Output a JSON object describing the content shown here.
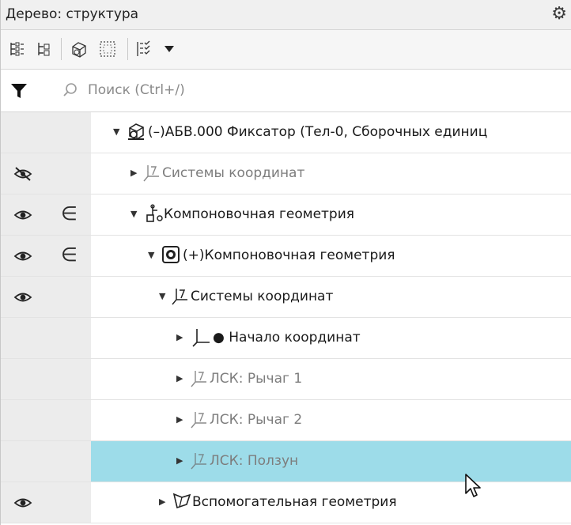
{
  "panel": {
    "title": "Дерево: структура",
    "settings_icon": "gear-icon"
  },
  "toolbar": {
    "buttons": [
      {
        "name": "tree-view-list-icon"
      },
      {
        "name": "tree-view-structure-icon"
      },
      {
        "name": "show-bodies-icon"
      },
      {
        "name": "select-frame-icon"
      },
      {
        "name": "filter-list-icon"
      },
      {
        "name": "dropdown-arrow-icon"
      }
    ]
  },
  "search": {
    "placeholder": "Поиск (Ctrl+/)",
    "value": ""
  },
  "tree": {
    "rows": [
      {
        "label": "(–)АБВ.000 Фиксатор (Тел-0, Сборочных единиц",
        "expanded": true,
        "eye": "",
        "member": "",
        "icon": "assembly-icon",
        "style": "dark"
      },
      {
        "label": "Системы координат",
        "expanded": false,
        "eye": "eye-hidden-icon",
        "member": "",
        "icon": "coordinate-system-icon",
        "style": "grey"
      },
      {
        "label": "Компоновочная геометрия",
        "expanded": true,
        "eye": "eye-icon",
        "member": "∈",
        "icon": "layout-geometry-icon",
        "style": "dark"
      },
      {
        "label": "(+)Компоновочная геометрия",
        "expanded": true,
        "eye": "eye-icon",
        "member": "∈",
        "icon": "component-icon",
        "style": "dark"
      },
      {
        "label": "Системы координат",
        "expanded": true,
        "eye": "eye-icon",
        "member": "",
        "icon": "coordinate-system-icon",
        "style": "dark"
      },
      {
        "label": "● Начало координат",
        "expanded": false,
        "eye": "",
        "member": "",
        "icon": "origin-icon",
        "style": "dark"
      },
      {
        "label": "ЛСК: Рычаг 1",
        "expanded": false,
        "eye": "",
        "member": "",
        "icon": "local-cs-icon",
        "style": "grey"
      },
      {
        "label": "ЛСК: Рычаг 2",
        "expanded": false,
        "eye": "",
        "member": "",
        "icon": "local-cs-icon",
        "style": "grey"
      },
      {
        "label": "ЛСК: Ползун",
        "expanded": false,
        "eye": "",
        "member": "",
        "icon": "local-cs-icon",
        "style": "grey",
        "selected": true
      },
      {
        "label": "Вспомогательная геометрия",
        "expanded": false,
        "eye": "eye-icon",
        "member": "",
        "icon": "auxiliary-geometry-icon",
        "style": "dark"
      }
    ]
  },
  "colors": {
    "selection": "#9ddce9",
    "gutter": "#ececec"
  }
}
